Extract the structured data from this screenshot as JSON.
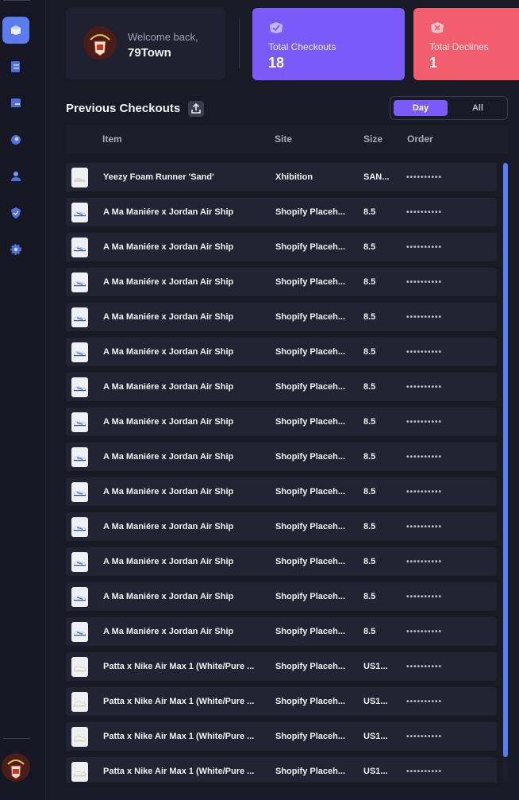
{
  "sidebar": {
    "items": [
      {
        "icon": "dashboard-icon",
        "active": true
      },
      {
        "icon": "tasks-icon",
        "active": false
      },
      {
        "icon": "profiles-icon",
        "active": false
      },
      {
        "icon": "proxies-icon",
        "active": false
      },
      {
        "icon": "accounts-icon",
        "active": false
      },
      {
        "icon": "captcha-shield-icon",
        "active": false
      },
      {
        "icon": "settings-gear-icon",
        "active": false
      }
    ],
    "accent": "#5b7bef"
  },
  "welcome": {
    "greeting": "Welcome back,",
    "username": "79Town"
  },
  "stats": {
    "checkouts": {
      "label": "Total Checkouts",
      "value": "18",
      "color": "#7a5af8"
    },
    "declines": {
      "label": "Total Declines",
      "value": "1",
      "color": "#f25e6e"
    }
  },
  "section": {
    "title": "Previous Checkouts"
  },
  "filter": {
    "options": [
      "Day",
      "All"
    ],
    "selected": "Day"
  },
  "table": {
    "columns": [
      "Item",
      "Site",
      "Size",
      "Order"
    ],
    "rows": [
      {
        "item": "Yeezy Foam Runner 'Sand'",
        "site": "Xhibition",
        "size": "SAN...",
        "order": "••••••••••"
      },
      {
        "item": "A Ma Maniére x Jordan Air Ship",
        "site": "Shopify Placeh...",
        "size": "8.5",
        "order": "••••••••••"
      },
      {
        "item": "A Ma Maniére x Jordan Air Ship",
        "site": "Shopify Placeh...",
        "size": "8.5",
        "order": "••••••••••"
      },
      {
        "item": "A Ma Maniére x Jordan Air Ship",
        "site": "Shopify Placeh...",
        "size": "8.5",
        "order": "••••••••••"
      },
      {
        "item": "A Ma Maniére x Jordan Air Ship",
        "site": "Shopify Placeh...",
        "size": "8.5",
        "order": "••••••••••"
      },
      {
        "item": "A Ma Maniére x Jordan Air Ship",
        "site": "Shopify Placeh...",
        "size": "8.5",
        "order": "••••••••••"
      },
      {
        "item": "A Ma Maniére x Jordan Air Ship",
        "site": "Shopify Placeh...",
        "size": "8.5",
        "order": "••••••••••"
      },
      {
        "item": "A Ma Maniére x Jordan Air Ship",
        "site": "Shopify Placeh...",
        "size": "8.5",
        "order": "••••••••••"
      },
      {
        "item": "A Ma Maniére x Jordan Air Ship",
        "site": "Shopify Placeh...",
        "size": "8.5",
        "order": "••••••••••"
      },
      {
        "item": "A Ma Maniére x Jordan Air Ship",
        "site": "Shopify Placeh...",
        "size": "8.5",
        "order": "••••••••••"
      },
      {
        "item": "A Ma Maniére x Jordan Air Ship",
        "site": "Shopify Placeh...",
        "size": "8.5",
        "order": "••••••••••"
      },
      {
        "item": "A Ma Maniére x Jordan Air Ship",
        "site": "Shopify Placeh...",
        "size": "8.5",
        "order": "••••••••••"
      },
      {
        "item": "A Ma Maniére x Jordan Air Ship",
        "site": "Shopify Placeh...",
        "size": "8.5",
        "order": "••••••••••"
      },
      {
        "item": "A Ma Maniére x Jordan Air Ship",
        "site": "Shopify Placeh...",
        "size": "8.5",
        "order": "••••••••••"
      },
      {
        "item": "Patta x Nike Air Max 1 (White/Pure ...",
        "site": "Shopify Placeh...",
        "size": "US1...",
        "order": "••••••••••"
      },
      {
        "item": "Patta x Nike Air Max 1 (White/Pure ...",
        "site": "Shopify Placeh...",
        "size": "US1...",
        "order": "••••••••••"
      },
      {
        "item": "Patta x Nike Air Max 1 (White/Pure ...",
        "site": "Shopify Placeh...",
        "size": "US1...",
        "order": "••••••••••"
      },
      {
        "item": "Patta x Nike Air Max 1 (White/Pure ...",
        "site": "Shopify Placeh...",
        "size": "US1...",
        "order": "••••••••••"
      }
    ]
  }
}
